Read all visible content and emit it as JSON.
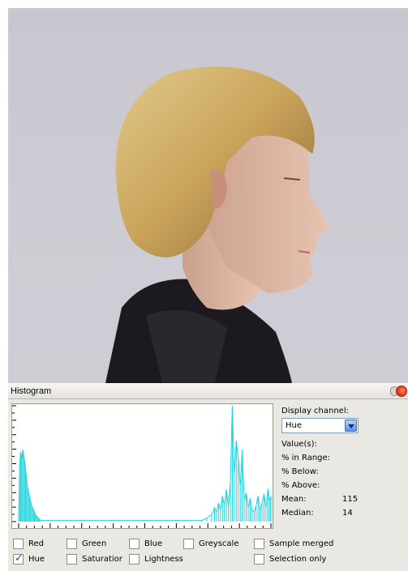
{
  "panel": {
    "title": "Histogram"
  },
  "info": {
    "display_channel_label": "Display channel:",
    "channel_selected": "Hue",
    "values_label": "Value(s):",
    "in_range_label": "% in Range:",
    "below_label": "% Below:",
    "above_label": "% Above:",
    "mean_label": "Mean:",
    "mean_value": "115",
    "median_label": "Median:",
    "median_value": "14"
  },
  "checkboxes": {
    "red": {
      "label": "Red",
      "checked": false
    },
    "green": {
      "label": "Green",
      "checked": false
    },
    "blue": {
      "label": "Blue",
      "checked": false
    },
    "greyscale": {
      "label": "Greyscale",
      "checked": false
    },
    "sample_merged": {
      "label": "Sample merged",
      "checked": false
    },
    "hue": {
      "label": "Hue",
      "checked": true
    },
    "saturation": {
      "label": "Saturatior",
      "checked": false
    },
    "lightness": {
      "label": "Lightness",
      "checked": false
    },
    "selection_only": {
      "label": "Selection only",
      "checked": false
    }
  },
  "colors": {
    "histogram_line": "#1fd4dc",
    "panel_bg": "#e9e8e3"
  },
  "chart_data": {
    "type": "line",
    "title": "",
    "xlabel": "",
    "ylabel": "",
    "xlim": [
      0,
      255
    ],
    "ylim": [
      0,
      100
    ],
    "series": [
      {
        "x": [
          0,
          1,
          2,
          3,
          4,
          5,
          6,
          7,
          8,
          9,
          10,
          11,
          12,
          13,
          14,
          15,
          16,
          17,
          18,
          19,
          20,
          21,
          22,
          185,
          190,
          195,
          198,
          200,
          202,
          204,
          206,
          208,
          210,
          212,
          214,
          216,
          218,
          220,
          222,
          224,
          226,
          228,
          230,
          232,
          234,
          236,
          238,
          240,
          242,
          244,
          246,
          248,
          250,
          252,
          254,
          255
        ],
        "y": [
          5,
          48,
          60,
          54,
          62,
          58,
          52,
          44,
          38,
          30,
          25,
          22,
          18,
          14,
          12,
          10,
          8,
          6,
          5,
          4,
          3,
          2,
          1,
          1,
          3,
          6,
          12,
          8,
          16,
          10,
          22,
          14,
          28,
          12,
          35,
          100,
          40,
          70,
          55,
          30,
          62,
          18,
          25,
          12,
          20,
          10,
          8,
          14,
          22,
          10,
          16,
          24,
          12,
          28,
          18,
          22
        ]
      }
    ]
  }
}
